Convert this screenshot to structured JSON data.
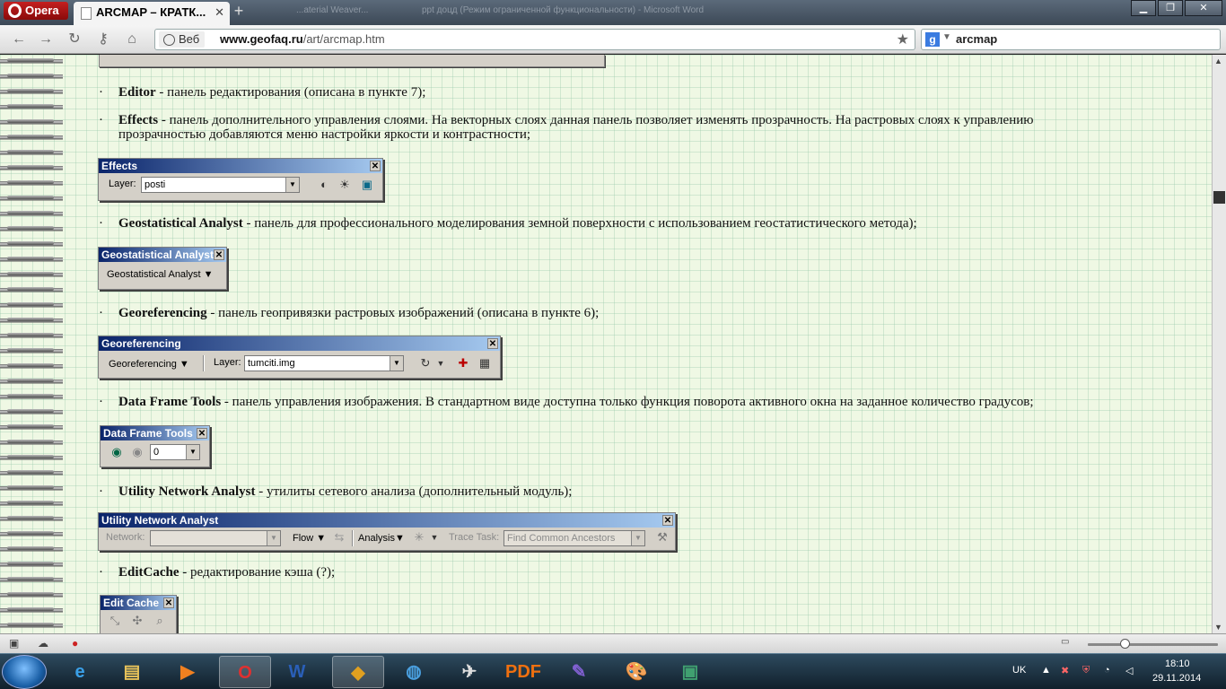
{
  "browser": {
    "menu_label": "Opera",
    "tab_title": "ARCMAP – КРАТК...",
    "tab_close": "✕",
    "new_tab": "+",
    "ghost_tabs": [
      "...aterial Weaver...",
      "ppt доцд (Режим ограниченной функциональности) - Microsoft Word"
    ],
    "window_buttons": [
      "▁",
      "❐",
      "✕"
    ],
    "nav": {
      "back": "←",
      "forward": "→",
      "reload": "↻",
      "key": "⚷",
      "home": "⌂"
    },
    "address": {
      "badge": "Веб",
      "host": "www.geofaq.ru",
      "path": "/art/arcmap.htm",
      "star": "★"
    },
    "search": {
      "engine": "g",
      "query": "arcmap"
    }
  },
  "content": {
    "editor": {
      "name": "Editor",
      "desc": " - панель редактирования (описана в пункте 7);"
    },
    "effects": {
      "name": "Effects",
      "desc": " - панель  дополнительного управления слоями. На векторных слоях данная панель позволяет изменять прозрачность. На растровых слоях к управлению",
      "cont": "прозрачностью добавляются меню настройки яркости и контрастности;"
    },
    "geostat": {
      "name": "Geostatistical Analyst",
      "desc": " - панель для профессионального моделирования земной поверхности с использованием геостатистического метода);"
    },
    "georef": {
      "name": "Georeferencing",
      "desc": " - панель геопривязки растровых изображений (описана в пункте 6);"
    },
    "dft": {
      "name": "Data Frame Tools",
      "desc": " - панель управления изображения. В стандартном виде доступна только функция поворота активного окна на заданное количество градусов;"
    },
    "una": {
      "name": "Utility Network Analyst",
      "desc": " - утилиты сетевого анализа (дополнительный модуль);"
    },
    "editcache": {
      "name": "EditCache",
      "desc": " - редактирование кэша (?);"
    },
    "bullet": "·"
  },
  "toolbars": {
    "effects": {
      "title": "Effects",
      "layer_label": "Layer:",
      "layer_value": "posti"
    },
    "geostat": {
      "title": "Geostatistical Analyst",
      "menu": "Geostatistical Analyst ▼"
    },
    "georef": {
      "title": "Georeferencing",
      "menu": "Georeferencing ▼",
      "layer_label": "Layer:",
      "layer_value": "tumciti.img"
    },
    "dft": {
      "title": "Data Frame Tools",
      "rotation": "0"
    },
    "una": {
      "title": "Utility Network Analyst",
      "network_label": "Network:",
      "flow": "Flow ▼",
      "analysis": "Analysis▼",
      "trace_label": "Trace Task:",
      "trace_value": "Find Common Ancestors"
    },
    "editcache": {
      "title": "Edit Cache"
    },
    "close": "✕",
    "dropdown": "▼"
  },
  "taskbar": {
    "lang": "UK",
    "time": "18:10",
    "date": "29.11.2014",
    "apps": [
      "ie",
      "explorer",
      "media",
      "opera",
      "word",
      "arcmap",
      "globe",
      "plane",
      "pdf",
      "pen",
      "paint",
      "image"
    ],
    "app_glyphs": [
      "e",
      "▤",
      "▶",
      "O",
      "W",
      "◆",
      "◍",
      "✈",
      "PDF",
      "✎",
      "🎨",
      "▣"
    ]
  },
  "colors": {
    "caption_start": "#0a246a",
    "caption_end": "#a6caf0",
    "page_bg": "#eff8e4",
    "opera_red": "#c42020"
  }
}
